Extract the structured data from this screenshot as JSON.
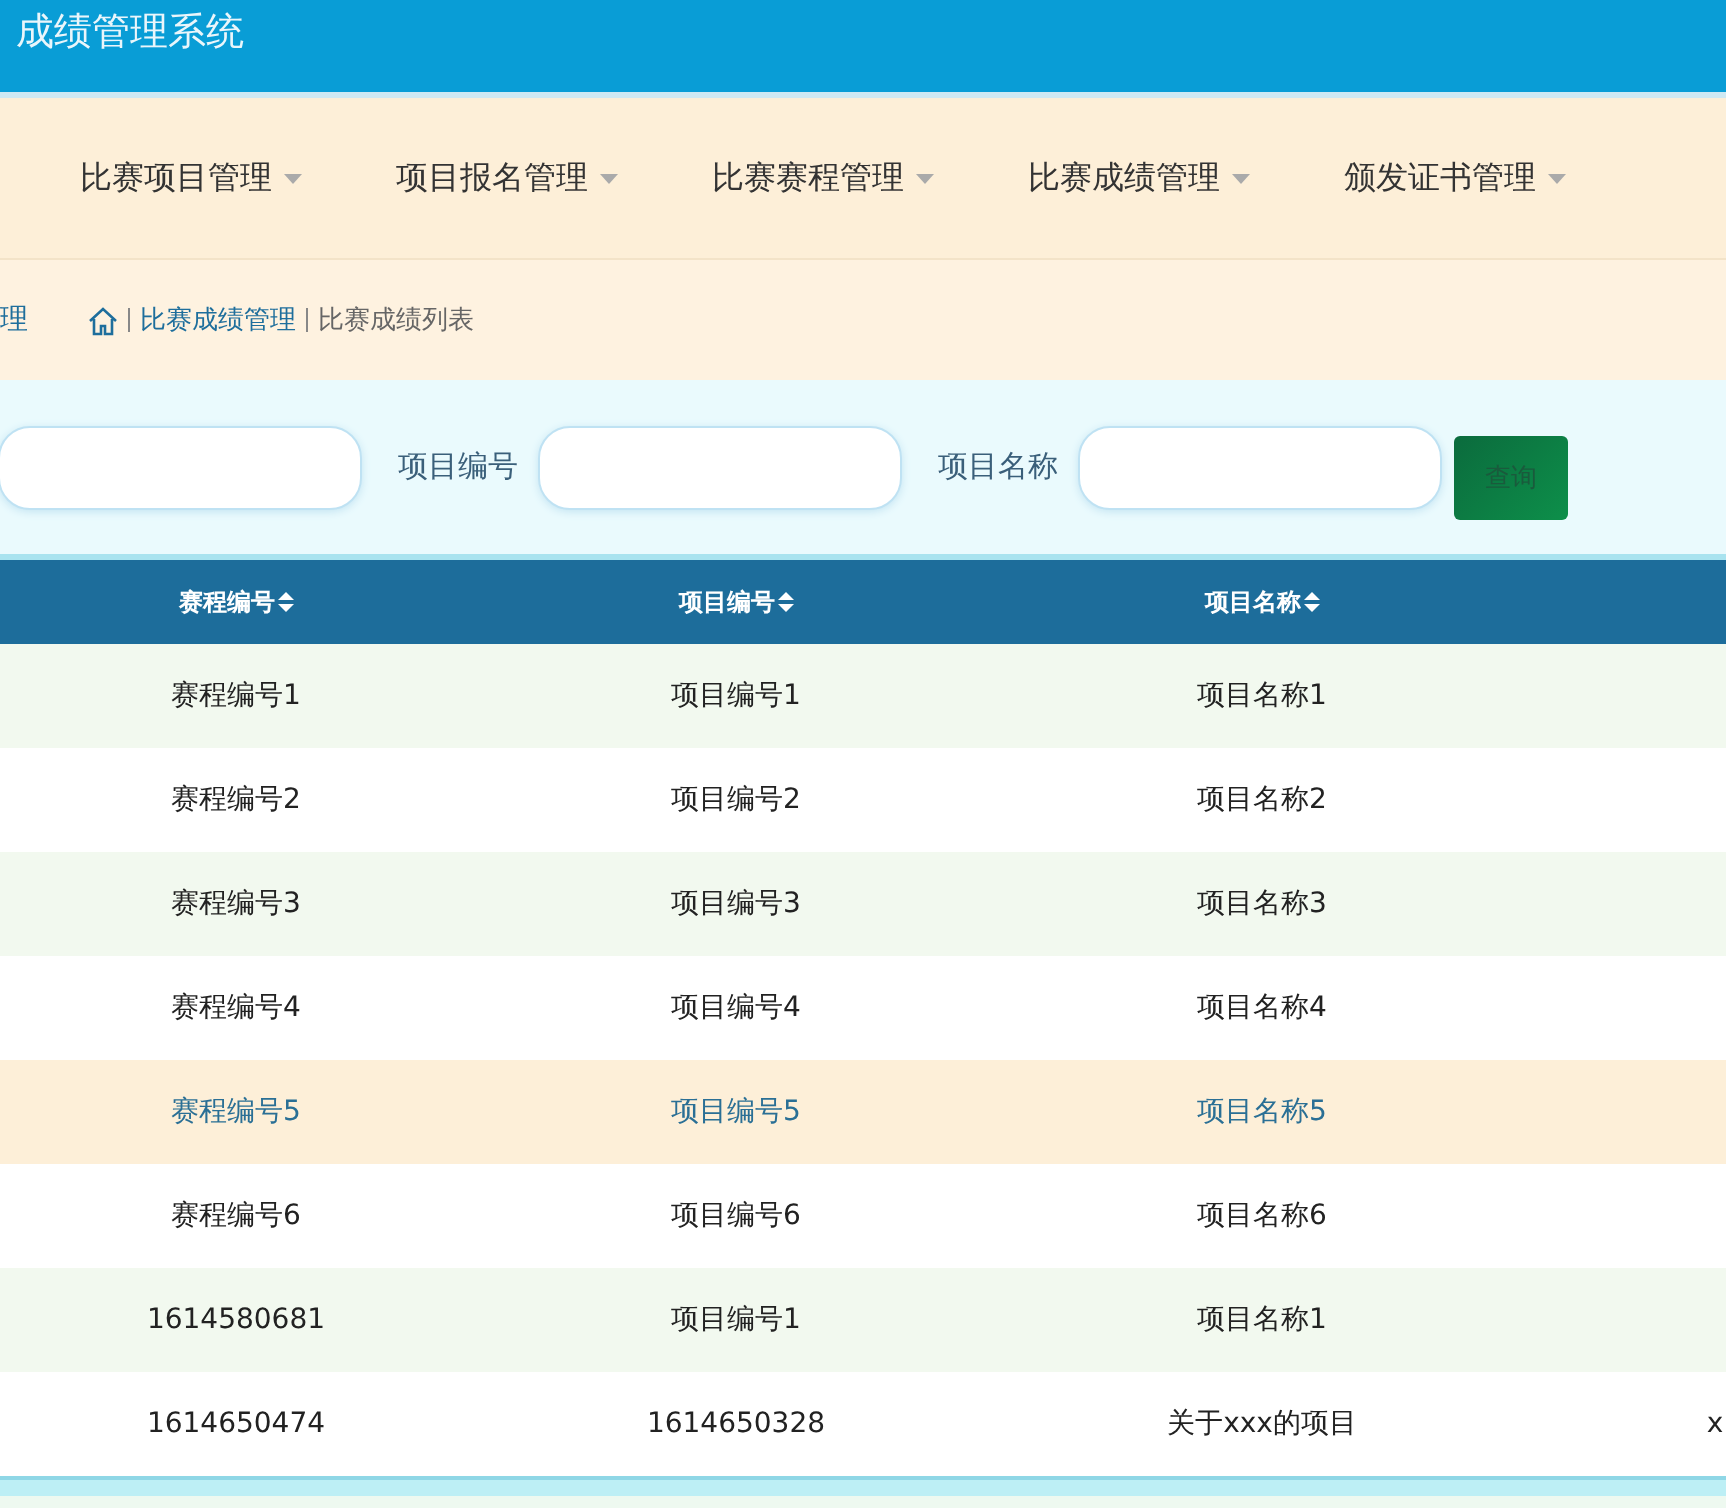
{
  "header": {
    "title": "成绩管理系统"
  },
  "nav": {
    "items": [
      {
        "label": "比赛项目管理"
      },
      {
        "label": "项目报名管理"
      },
      {
        "label": "比赛赛程管理"
      },
      {
        "label": "比赛成绩管理"
      },
      {
        "label": "颁发证书管理"
      }
    ]
  },
  "breadcrumb": {
    "left_text": "理",
    "items": [
      "比赛成绩管理",
      "比赛成绩列表"
    ]
  },
  "search": {
    "fields": [
      {
        "kind": "plain"
      },
      {
        "kind": "labeled",
        "label": "项目编号"
      },
      {
        "kind": "labeled",
        "label": "项目名称"
      }
    ],
    "button": "查询"
  },
  "table": {
    "columns": [
      "赛程编号",
      "项目编号",
      "项目名称"
    ],
    "rows": [
      {
        "cells": [
          "赛程编号1",
          "项目编号1",
          "项目名称1"
        ],
        "highlighted": false
      },
      {
        "cells": [
          "赛程编号2",
          "项目编号2",
          "项目名称2"
        ],
        "highlighted": false
      },
      {
        "cells": [
          "赛程编号3",
          "项目编号3",
          "项目名称3"
        ],
        "highlighted": false
      },
      {
        "cells": [
          "赛程编号4",
          "项目编号4",
          "项目名称4"
        ],
        "highlighted": false
      },
      {
        "cells": [
          "赛程编号5",
          "项目编号5",
          "项目名称5"
        ],
        "highlighted": true
      },
      {
        "cells": [
          "赛程编号6",
          "项目编号6",
          "项目名称6"
        ],
        "highlighted": false
      },
      {
        "cells": [
          "1614580681",
          "项目编号1",
          "项目名称1"
        ],
        "highlighted": false
      },
      {
        "cells": [
          "1614650474",
          "1614650328",
          "关于xxx的项目"
        ],
        "column_4": "x",
        "highlighted": false
      }
    ]
  }
}
